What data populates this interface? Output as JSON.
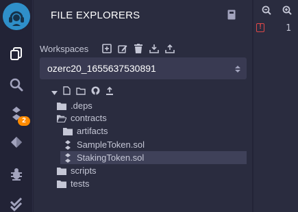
{
  "panel": {
    "title": "FILE EXPLORERS"
  },
  "workspaces": {
    "label": "Workspaces",
    "selected": "ozerc20_1655637530891"
  },
  "rail": {
    "badge_count": "2"
  },
  "tree": {
    "items": [
      {
        "label": ".deps",
        "icon": "folder-icon"
      },
      {
        "label": "contracts",
        "icon": "folder-open-icon"
      },
      {
        "label": "artifacts",
        "icon": "folder-icon"
      },
      {
        "label": "SampleToken.sol",
        "icon": "solidity-file-icon"
      },
      {
        "label": "StakingToken.sol",
        "icon": "solidity-file-icon"
      },
      {
        "label": "scripts",
        "icon": "folder-icon"
      },
      {
        "label": "tests",
        "icon": "folder-icon"
      }
    ]
  },
  "editor": {
    "line_number": "1"
  },
  "colors": {
    "accent_badge": "#ff8b00",
    "logo": "#2f8fc9",
    "warning": "#e04848",
    "selected_row": "#3f4159"
  }
}
